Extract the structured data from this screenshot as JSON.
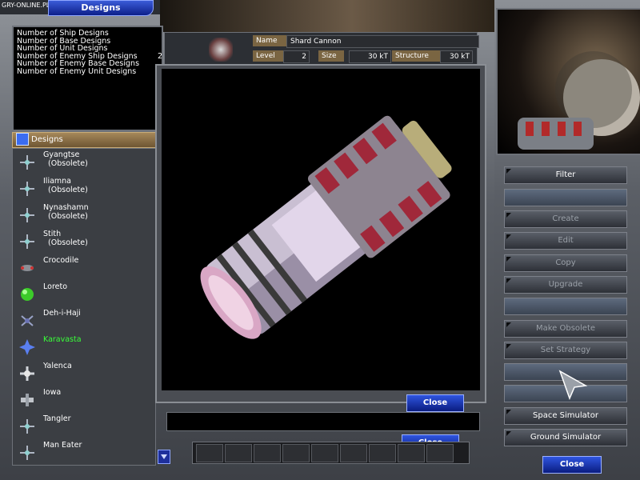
{
  "watermark": "GRY-ONLINE.PL",
  "window_title": "Designs",
  "stats": [
    "Number of Ship Designs",
    "Number of Base Designs",
    "Number of Unit Designs",
    "Number of Enemy Ship Designs",
    "Number of Enemy Base Designs",
    "Number of Enemy Unit Designs"
  ],
  "stats_value_partial": "2",
  "designs_header": "Designs",
  "designs": [
    {
      "name": "Gyangtse",
      "status": "(Obsolete)"
    },
    {
      "name": "Iliamna",
      "status": "(Obsolete)"
    },
    {
      "name": "Nynashamn",
      "status": "(Obsolete)"
    },
    {
      "name": "Stith",
      "status": "(Obsolete)"
    },
    {
      "name": "Crocodile",
      "status": ""
    },
    {
      "name": "Loreto",
      "status": ""
    },
    {
      "name": "Deh-i-Haji",
      "status": ""
    },
    {
      "name": "Karavasta",
      "status": ""
    },
    {
      "name": "Yalenca",
      "status": ""
    },
    {
      "name": "Iowa",
      "status": ""
    },
    {
      "name": "Tangler",
      "status": ""
    },
    {
      "name": "Man Eater",
      "status": ""
    }
  ],
  "selected_design": "Karavasta",
  "info": {
    "name_label": "Name",
    "name_value": "Shard Cannon",
    "level_label": "Level",
    "level_value": "2",
    "size_label": "Size",
    "size_value": "30 kT",
    "structure_label": "Structure",
    "structure_value": "30 kT"
  },
  "viewer_close": "Close",
  "panel_close": "Close",
  "right_buttons": {
    "filter": "Filter",
    "create": "Create",
    "edit": "Edit",
    "copy": "Copy",
    "upgrade": "Upgrade",
    "make_obsolete": "Make Obsolete",
    "set_strategy": "Set Strategy",
    "space_simulator": "Space Simulator",
    "ground_simulator": "Ground Simulator",
    "close": "Close"
  }
}
